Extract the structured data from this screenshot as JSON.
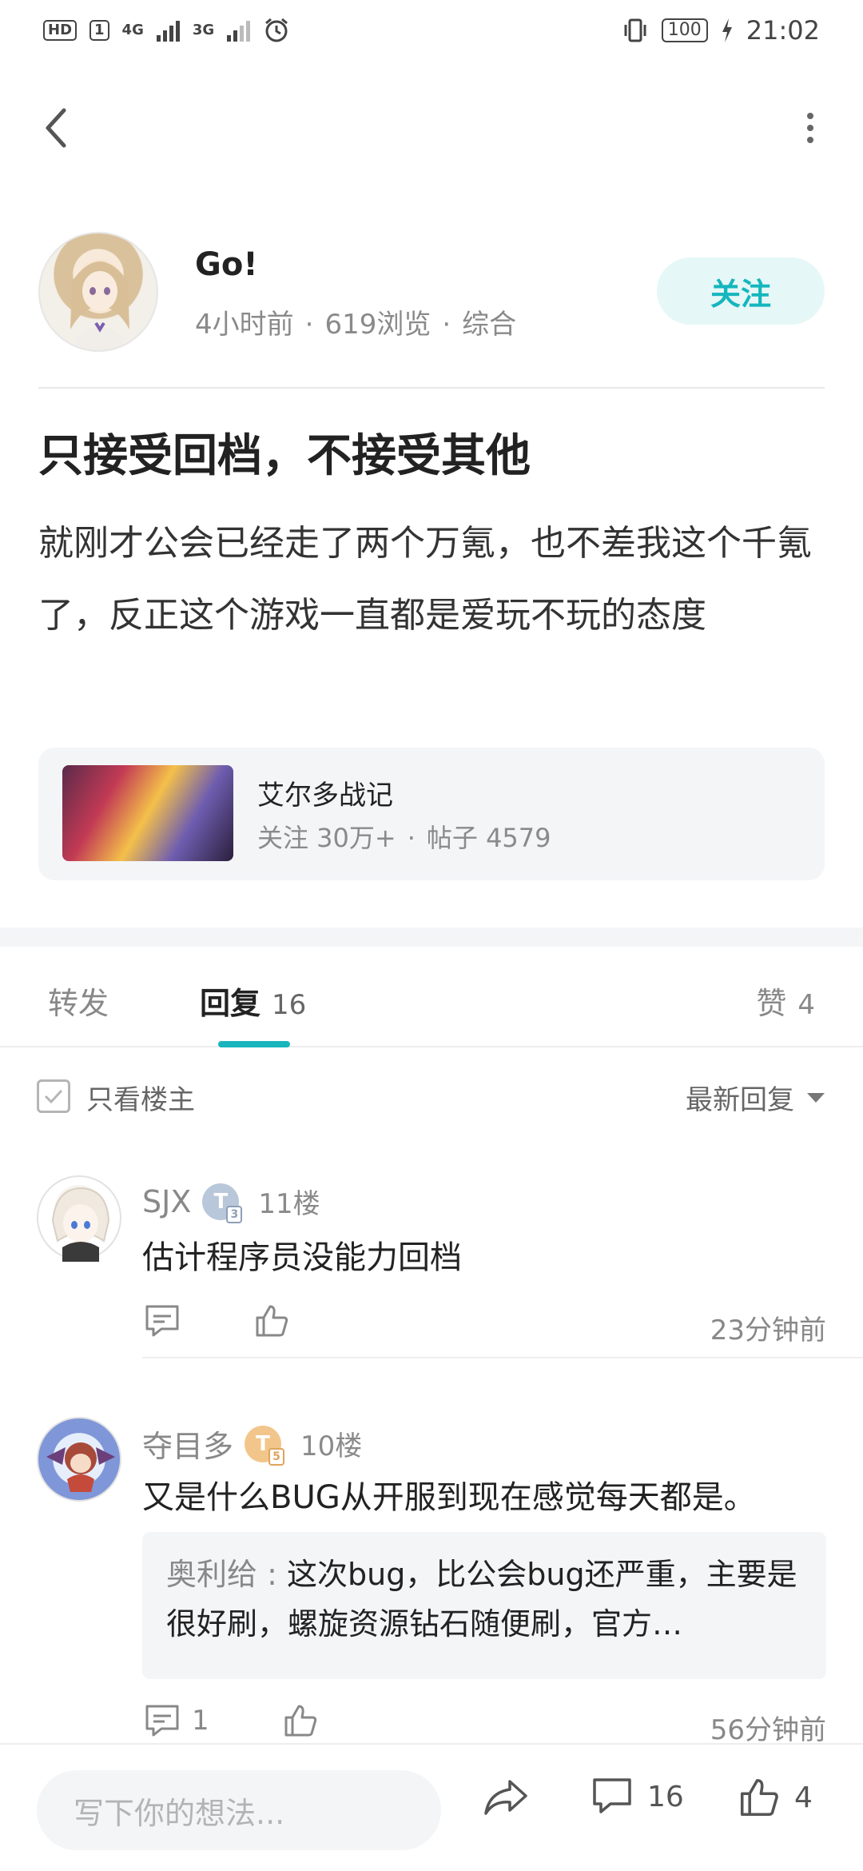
{
  "status_bar": {
    "hd_badge": "HD",
    "sim1_badge": "1",
    "net1": "4G",
    "net2": "3G",
    "battery": "100",
    "time": "21:02"
  },
  "nav": {
    "back_icon": "chevron-left-icon",
    "more_icon": "more-vertical-icon"
  },
  "author": {
    "name": "Go!",
    "time": "4小时前",
    "views": "619浏览",
    "category": "综合",
    "follow_label": "关注"
  },
  "post": {
    "title": "只接受回档，不接受其他",
    "body": "就刚才公会已经走了两个万氪，也不差我这个千氪了，反正这个游戏一直都是爱玩不玩的态度"
  },
  "forum": {
    "name": "艾尔多战记",
    "followers": "关注 30万+",
    "posts": "帖子 4579"
  },
  "tabs": {
    "repost": "转发",
    "reply": "回复",
    "reply_count": "16",
    "like": "赞",
    "like_count": "4"
  },
  "filter": {
    "only_op": "只看楼主",
    "sort": "最新回复"
  },
  "comments": [
    {
      "user": "SJX",
      "level_letter": "T",
      "level_num": "3",
      "floor": "11楼",
      "text": "估计程序员没能力回档",
      "time": "23分钟前"
    },
    {
      "user": "夺目多",
      "level_letter": "T",
      "level_num": "5",
      "floor": "10楼",
      "text": "又是什么BUG从开服到现在感觉每天都是。",
      "quote_user": "奥利给",
      "quote_text": "这次bug，比公会bug还严重，主要是很好刷，螺旋资源钻石随便刷，官方…",
      "reply_count": "1",
      "time": "56分钟前"
    }
  ],
  "bottom": {
    "placeholder": "写下你的想法...",
    "comment_count": "16",
    "like_count": "4"
  },
  "colors": {
    "accent": "#18b5bd",
    "follow_bg": "#e6f7f7"
  }
}
